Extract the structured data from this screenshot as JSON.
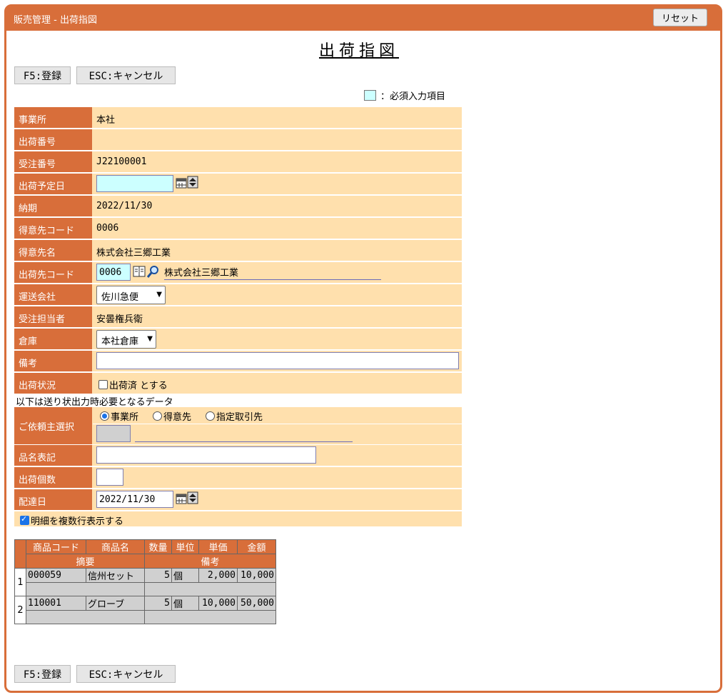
{
  "app": {
    "title": "販売管理 - 出荷指図",
    "reset_label": "リセット"
  },
  "page": {
    "title": "出荷指図"
  },
  "toolbar": {
    "register_label": "F5:登録",
    "cancel_label": "ESC:キャンセル"
  },
  "legend": {
    "text": "：必須入力項目",
    "required_color": "#ccffff"
  },
  "fields": {
    "office": {
      "label": "事業所",
      "value": "本社"
    },
    "shipment_no": {
      "label": "出荷番号",
      "value": ""
    },
    "order_no": {
      "label": "受注番号",
      "value": "J22100001"
    },
    "planned_date": {
      "label": "出荷予定日",
      "value": ""
    },
    "due_date": {
      "label": "納期",
      "value": "2022/11/30"
    },
    "customer_code": {
      "label": "得意先コード",
      "value": "0006"
    },
    "customer_name": {
      "label": "得意先名",
      "value": "株式会社三郷工業"
    },
    "ship_to_code": {
      "label": "出荷先コード",
      "value": "0006",
      "name": "株式会社三郷工業"
    },
    "carrier": {
      "label": "運送会社",
      "value": "佐川急便"
    },
    "rep": {
      "label": "受注担当者",
      "value": "安曇権兵衛"
    },
    "warehouse": {
      "label": "倉庫",
      "value": "本社倉庫"
    },
    "remarks": {
      "label": "備考",
      "value": ""
    },
    "status": {
      "label": "出荷状況",
      "checkbox_label": "出荷済 とする"
    }
  },
  "note": "以下は送り状出力時必要となるデータ",
  "shipping": {
    "requester": {
      "label": "ご依頼主選択",
      "options": [
        "事業所",
        "得意先",
        "指定取引先"
      ],
      "selected": "事業所"
    },
    "item_label": {
      "label": "品名表記",
      "value": ""
    },
    "count": {
      "label": "出荷個数",
      "value": ""
    },
    "delivery_date": {
      "label": "配達日",
      "value": "2022/11/30"
    },
    "multi_line": {
      "label": "明細を複数行表示する",
      "checked": true
    }
  },
  "grid": {
    "headers": [
      "商品コード",
      "商品名",
      "数量",
      "単位",
      "単価",
      "金額"
    ],
    "sub_headers": [
      "摘要",
      "備考"
    ],
    "rows": [
      {
        "no": "1",
        "code": "000059",
        "name": "信州セット",
        "qty": "5",
        "unit": "個",
        "price": "2,000",
        "amount": "10,000"
      },
      {
        "no": "2",
        "code": "110001",
        "name": "グローブ",
        "qty": "5",
        "unit": "個",
        "price": "10,000",
        "amount": "50,000"
      }
    ]
  },
  "colors": {
    "accent": "#d86e3a",
    "row_bg": "#ffe0ad",
    "grid_cell": "#d0d0d0"
  }
}
